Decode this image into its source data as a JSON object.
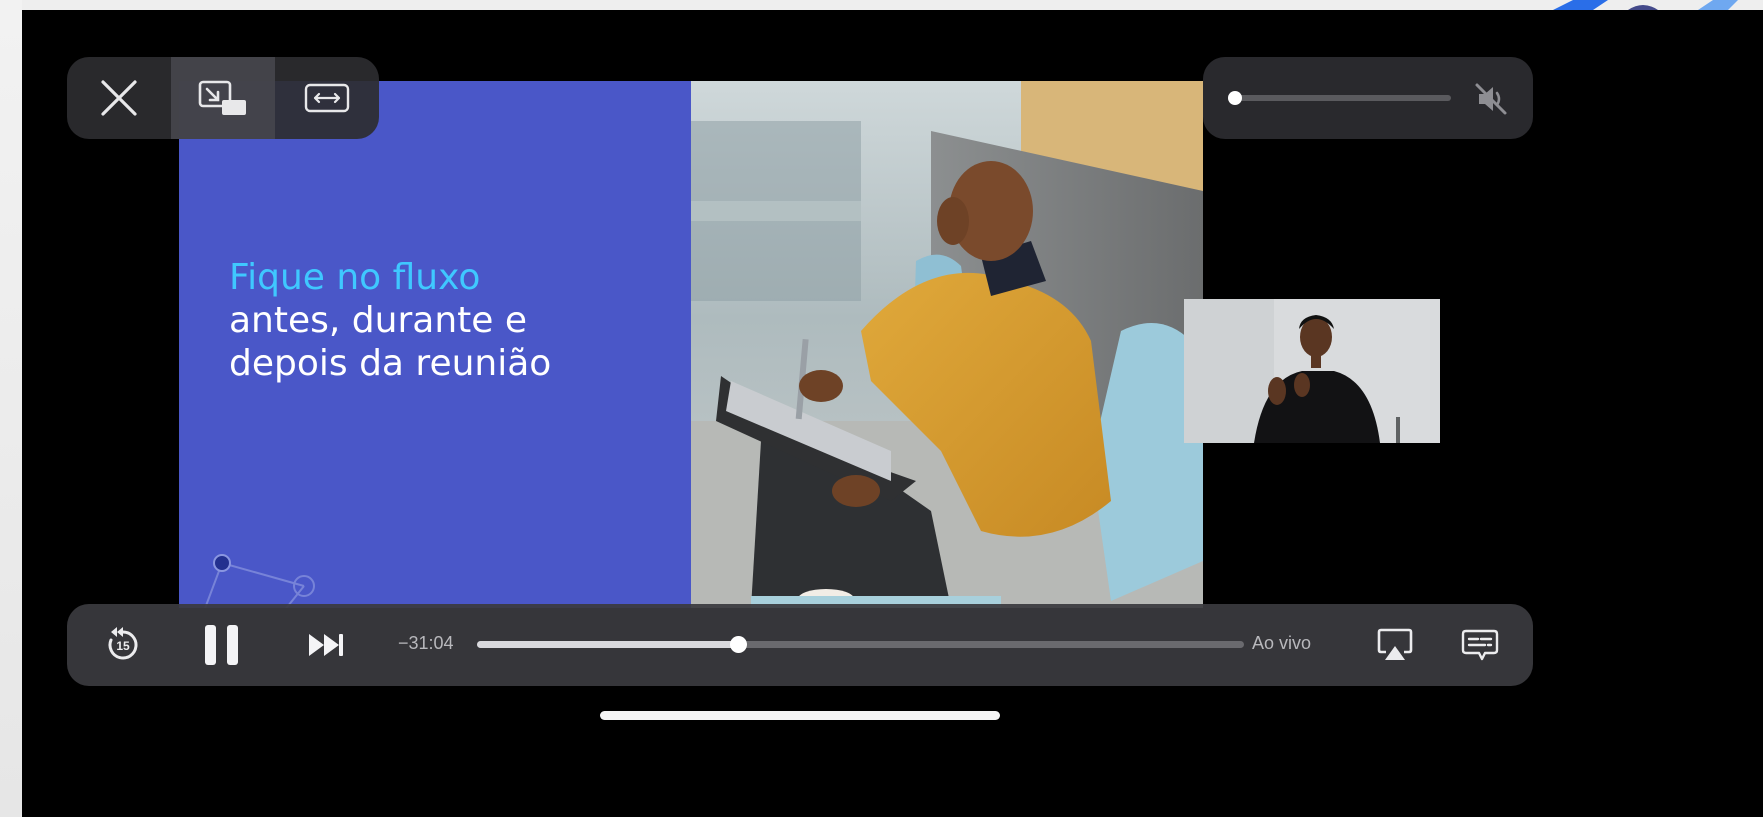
{
  "slide": {
    "title_highlight": "Fique no fluxo",
    "title_line2": "antes, durante e",
    "title_line3": "depois da reunião"
  },
  "top_controls": {
    "close_icon": "close-icon",
    "pip_icon": "picture-in-picture-icon",
    "fill_icon": "aspect-fill-icon"
  },
  "volume": {
    "level": 0.0,
    "muted": true,
    "mute_icon": "speaker-muted-icon"
  },
  "playback": {
    "skip_back_seconds": "15",
    "time_remaining": "−31:04",
    "progress": 0.34,
    "live_label": "Ao vivo",
    "state": "playing"
  },
  "colors": {
    "slide_blue": "#4a57c8",
    "highlight_cyan": "#3fc8ff",
    "control_bg": "#2c2c30"
  }
}
